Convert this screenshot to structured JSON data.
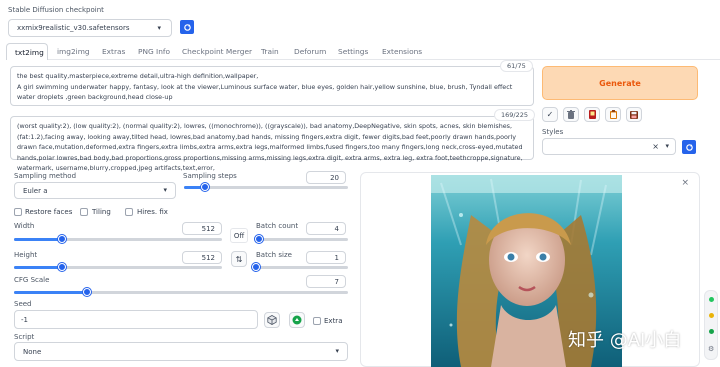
{
  "checkpoint": {
    "label": "Stable Diffusion checkpoint",
    "value": "xxmix9realistic_v30.safetensors"
  },
  "tabs": [
    "txt2img",
    "img2img",
    "Extras",
    "PNG Info",
    "Checkpoint Merger",
    "Train",
    "Deforum",
    "Settings",
    "Extensions"
  ],
  "prompt": {
    "text": "the best quality,masterpiece,extreme detail,ultra-high definition,wallpaper,\nA girl swimming underwater happy, fantasy, look at the viewer,Luminous surface water, blue eyes, golden hair,yellow sunshine, blue, brush, Tyndall effect water droplets ,green background,head close-up",
    "counter": "61/75"
  },
  "negative_prompt": {
    "text": "(worst quality:2), (low quality:2), (normal quality:2), lowres, ((monochrome)), ((grayscale)), bad anatomy,DeepNegative, skin spots, acnes, skin blemishes,(fat:1.2),facing away, looking away,tilted head, lowres,bad anatomy,bad hands, missing fingers,extra digit, fewer digits,bad feet,poorly drawn hands,poorly drawn face,mutation,deformed,extra fingers,extra limbs,extra arms,extra legs,malformed limbs,fused fingers,too many fingers,long neck,cross-eyed,mutated hands,polar lowres,bad body,bad proportions,gross proportions,missing arms,missing legs,extra digit, extra arms, extra leg, extra foot,teethcroppe,signature, watermark, username,blurry,cropped,jpeg artifacts,text,error,",
    "counter": "169/225"
  },
  "generate_label": "Generate",
  "styles_label": "Styles",
  "sampling_method": {
    "label": "Sampling method",
    "value": "Euler a"
  },
  "sampling_steps": {
    "label": "Sampling steps",
    "value": "20",
    "fraction": 0.13
  },
  "checkboxes": {
    "restore_faces": "Restore faces",
    "tiling": "Tiling",
    "hires_fix": "Hires. fix"
  },
  "width": {
    "label": "Width",
    "value": "512",
    "fraction": 0.23
  },
  "height": {
    "label": "Height",
    "value": "512",
    "fraction": 0.23
  },
  "swap_label": "Off",
  "batch_count": {
    "label": "Batch count",
    "value": "4",
    "fraction": 0.03
  },
  "batch_size": {
    "label": "Batch size",
    "value": "1",
    "fraction": 0.0
  },
  "cfg_scale": {
    "label": "CFG Scale",
    "value": "7",
    "fraction": 0.22
  },
  "seed": {
    "label": "Seed",
    "value": "-1",
    "extra_label": "Extra"
  },
  "script": {
    "label": "Script",
    "value": "None"
  },
  "watermark": "知乎 @AI小白",
  "close_glyph": "×",
  "colors": {
    "accent": "#3b82f6",
    "generate_bg": "#fdd9b4",
    "generate_text": "#ea580c"
  }
}
